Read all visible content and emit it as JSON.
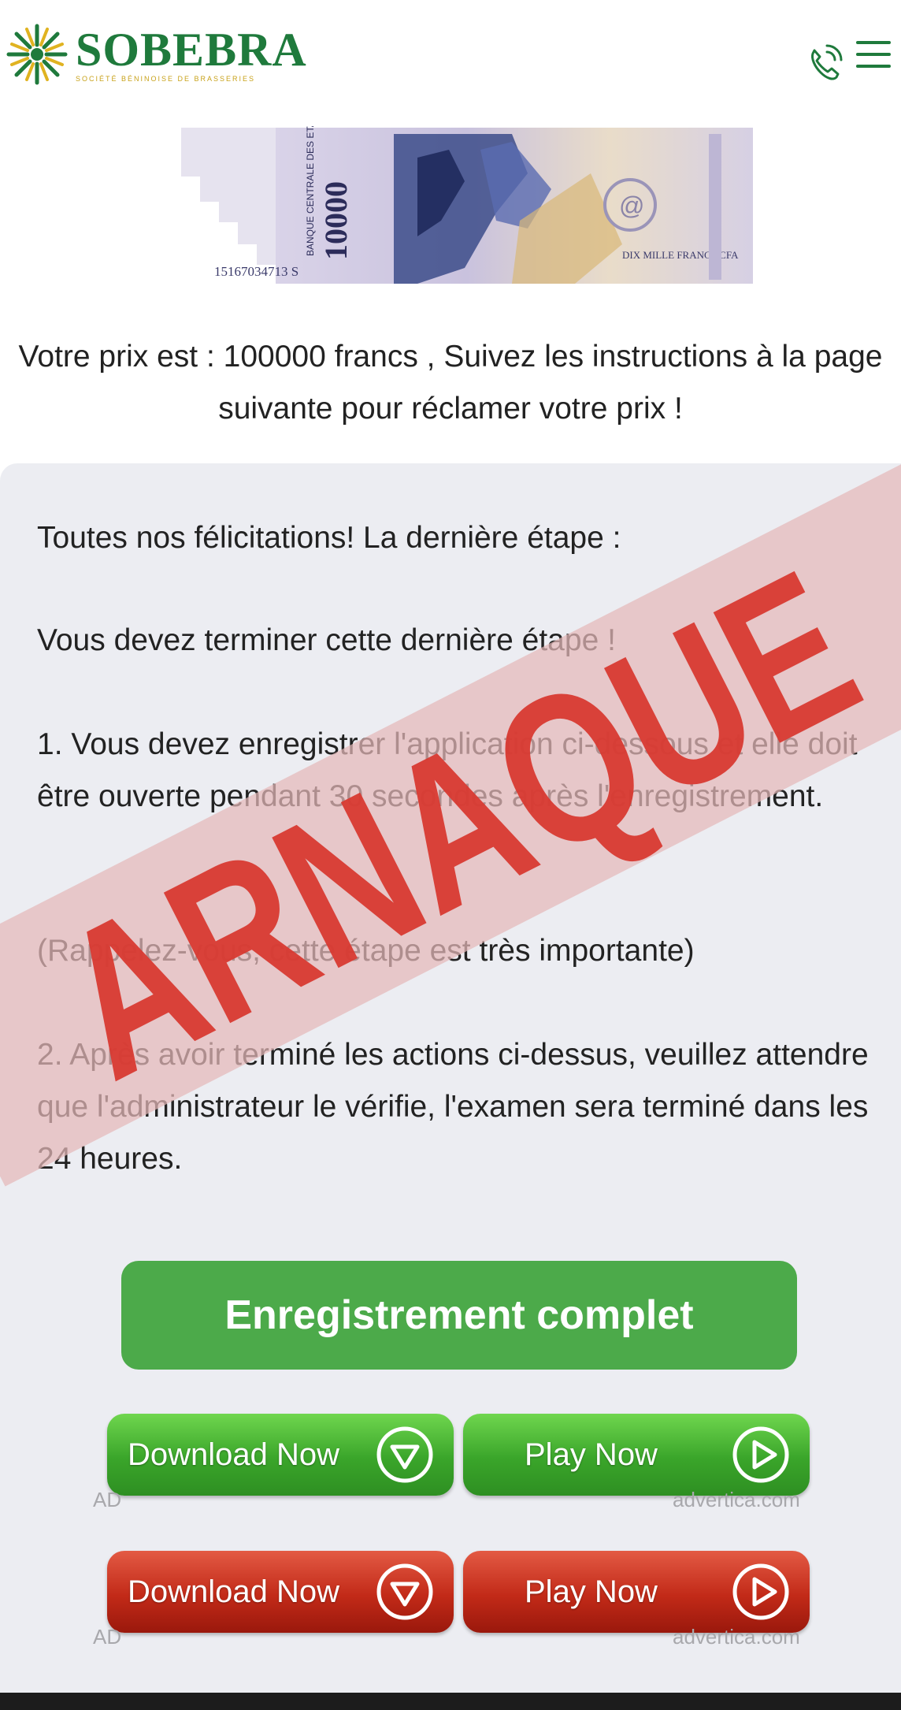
{
  "header": {
    "logo_name": "SOBEBRA",
    "logo_subtitle": "SOCIÉTÉ BÉNINOISE DE BRASSERIES",
    "phone_icon": "phone-icon",
    "menu_icon": "hamburger-menu-icon"
  },
  "banknote": {
    "serial": "15167034713 S",
    "value": "10000",
    "bank_text": "BANQUE CENTRALE DES ETATS DE L'AFRIQUE",
    "denomination_text": "DIX MILLE FRANCS CFA"
  },
  "prize_text": "Votre prix est : 100000 francs , Suivez les instructions à la page suivante pour réclamer votre prix !",
  "card": {
    "congrats": "Toutes nos félicitations! La dernière étape :",
    "must_finish": "Vous devez terminer cette dernière étape !",
    "step1": "1. Vous devez enregistrer l'application ci-dessous et elle doit être ouverte pendant 30 secondes après l'enregistrement.",
    "reminder": "(Rappelez-vous, cette étape est très importante)",
    "step2": "2. Après avoir terminé les actions ci-dessus, veuillez attendre que l'administrateur le vérifie, l'examen sera terminé dans les 24 heures."
  },
  "cta_label": "Enregistrement complet",
  "ads": {
    "row1": {
      "download_label": "Download Now",
      "play_label": "Play Now",
      "ad_label": "AD",
      "source": "advertica.com"
    },
    "row2": {
      "download_label": "Download Now",
      "play_label": "Play Now",
      "ad_label": "AD",
      "source": "advertica.com"
    }
  },
  "stamp_text": "ARNAQUE",
  "colors": {
    "brand_green": "#1f7a3c",
    "cta_green": "#4caa4a",
    "stamp_red": "#d93a32",
    "stamp_band": "#e4b8b8",
    "card_bg": "#ecedf2"
  }
}
